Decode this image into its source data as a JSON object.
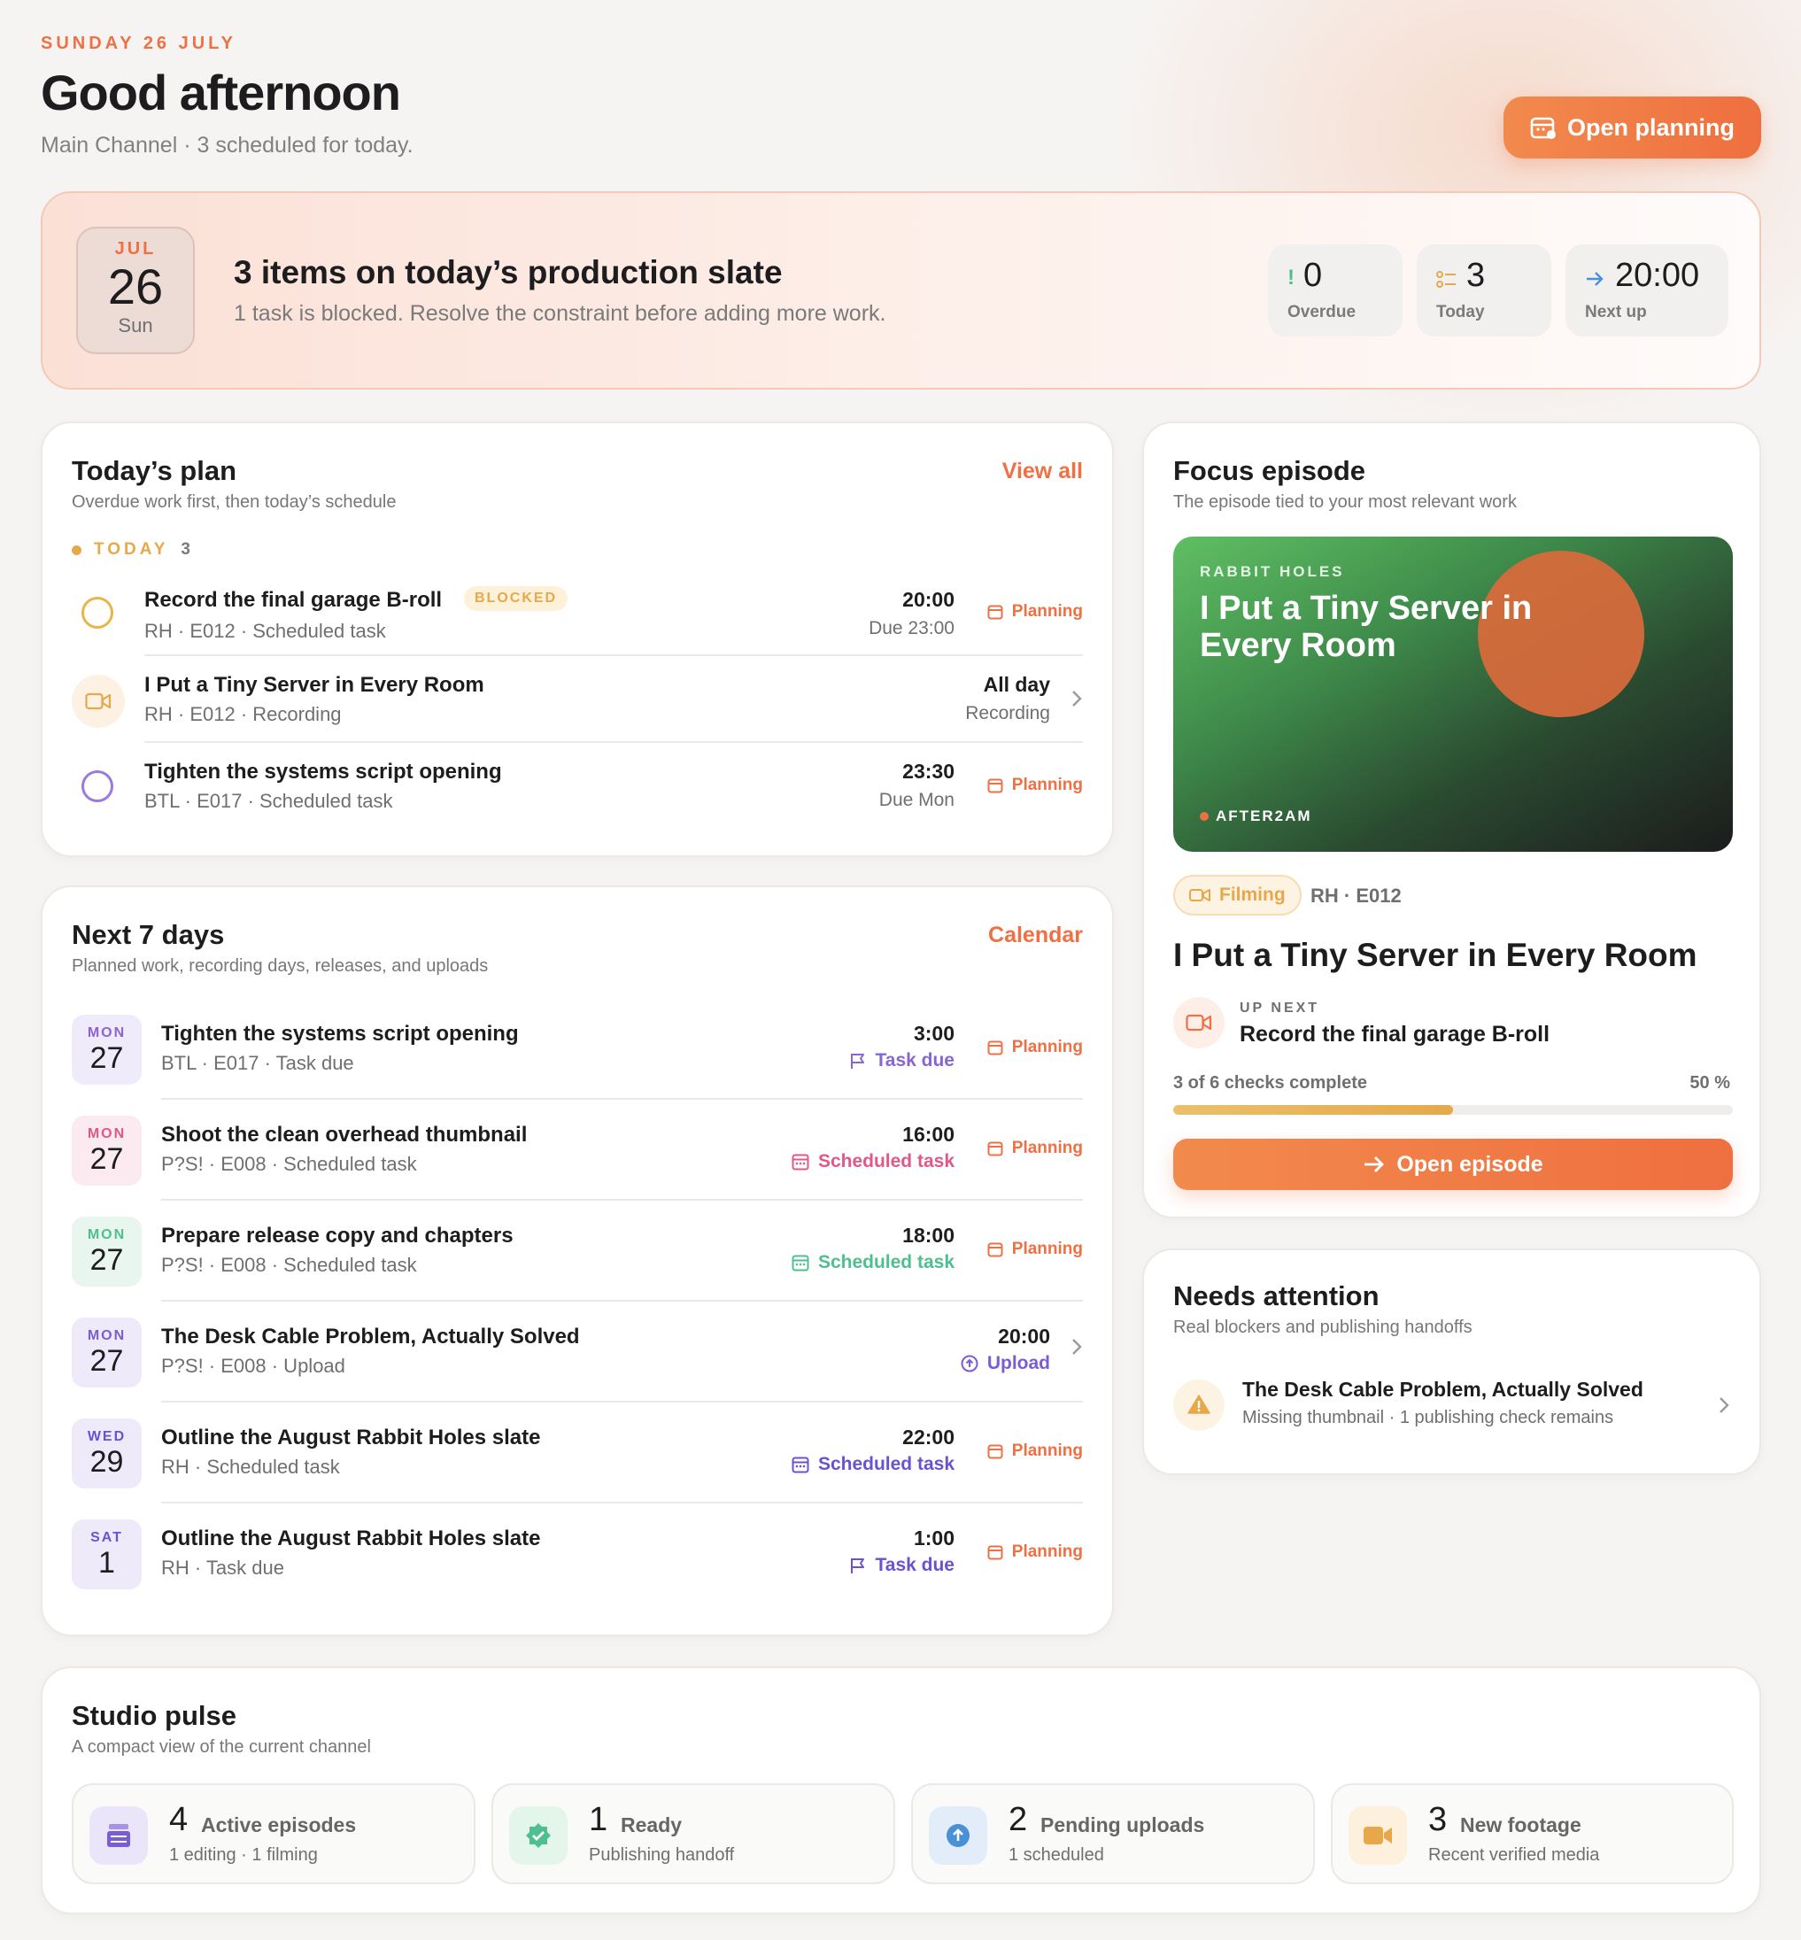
{
  "header": {
    "date_eyebrow": "SUNDAY 26 JULY",
    "greeting": "Good afternoon",
    "subtitle": "Main Channel · 3 scheduled for today.",
    "open_planning_label": "Open planning"
  },
  "slate": {
    "month": "JUL",
    "day": "26",
    "weekday": "Sun",
    "title": "3 items on today’s production slate",
    "subtitle": "1 task is blocked. Resolve the constraint before adding more work.",
    "stats": [
      {
        "icon": "exclamation-icon",
        "value": "0",
        "label": "Overdue"
      },
      {
        "icon": "list-icon",
        "value": "3",
        "label": "Today"
      },
      {
        "icon": "arrow-right-icon",
        "value": "20:00",
        "label": "Next up"
      }
    ]
  },
  "today_plan": {
    "title": "Today’s plan",
    "subtitle": "Overdue work first, then today’s schedule",
    "view_all": "View all",
    "section_label": "TODAY",
    "section_count": "3",
    "items": [
      {
        "title": "Record the final garage B-roll",
        "badge": "BLOCKED",
        "meta": "RH · E012 · Scheduled task",
        "time": "20:00",
        "due": "Due 23:00",
        "action": "Planning"
      },
      {
        "title": "I Put a Tiny Server in Every Room",
        "meta": "RH · E012 · Recording",
        "time": "All day",
        "due": "Recording"
      },
      {
        "title": "Tighten the systems script opening",
        "meta": "BTL · E017 · Scheduled task",
        "time": "23:30",
        "due": "Due Mon",
        "action": "Planning"
      }
    ]
  },
  "next7": {
    "title": "Next 7 days",
    "subtitle": "Planned work, recording days, releases, and uploads",
    "link": "Calendar",
    "items": [
      {
        "dow": "MON",
        "day": "27",
        "title": "Tighten the systems script opening",
        "meta": "BTL · E017 · Task due",
        "time": "3:00",
        "tag": "Task due",
        "action": "Planning",
        "color": "#8a64d6",
        "bg": "#f0ebfa"
      },
      {
        "dow": "MON",
        "day": "27",
        "title": "Shoot the clean overhead thumbnail",
        "meta": "P?S! · E008 · Scheduled task",
        "time": "16:00",
        "tag": "Scheduled task",
        "action": "Planning",
        "color": "#e0588a",
        "bg": "#fbeaf0"
      },
      {
        "dow": "MON",
        "day": "27",
        "title": "Prepare release copy and chapters",
        "meta": "P?S! · E008 · Scheduled task",
        "time": "18:00",
        "tag": "Scheduled task",
        "action": "Planning",
        "color": "#4fbf8f",
        "bg": "#e8f6ef"
      },
      {
        "dow": "MON",
        "day": "27",
        "title": "The Desk Cable Problem, Actually Solved",
        "meta": "P?S! · E008 · Upload",
        "time": "20:00",
        "tag": "Upload",
        "color": "#7a5cd6",
        "bg": "#efeafa"
      },
      {
        "dow": "WED",
        "day": "29",
        "title": "Outline the August Rabbit Holes slate",
        "meta": "RH · Scheduled task",
        "time": "22:00",
        "tag": "Scheduled task",
        "action": "Planning",
        "color": "#6a52d0",
        "bg": "#eeeafa"
      },
      {
        "dow": "SAT",
        "day": "1",
        "title": "Outline the August Rabbit Holes slate",
        "meta": "RH · Task due",
        "time": "1:00",
        "tag": "Task due",
        "action": "Planning",
        "color": "#6a52d0",
        "bg": "#eeeafa"
      }
    ]
  },
  "focus": {
    "title": "Focus episode",
    "subtitle": "The episode tied to your most relevant work",
    "thumb_series": "RABBIT HOLES",
    "thumb_title": "I Put a Tiny Server in Every Room",
    "thumb_brand": "AFTER2AM",
    "status": "Filming",
    "code": "RH · E012",
    "episode_title": "I Put a Tiny Server in Every Room",
    "up_next_label": "UP NEXT",
    "up_next_task": "Record the final garage B-roll",
    "progress_text": "3 of 6 checks complete",
    "progress_pct": "50 %",
    "progress_value": 0.5,
    "open_label": "Open episode"
  },
  "attention": {
    "title": "Needs attention",
    "subtitle": "Real blockers and publishing handoffs",
    "item_title": "The Desk Cable Problem, Actually Solved",
    "item_meta": "Missing thumbnail · 1 publishing check remains"
  },
  "pulse": {
    "title": "Studio pulse",
    "subtitle": "A compact view of the current channel",
    "cards": [
      {
        "icon": "film-stack-icon",
        "num": "4",
        "label": "Active episodes",
        "sub": "1 editing · 1 filming"
      },
      {
        "icon": "check-badge-icon",
        "num": "1",
        "label": "Ready",
        "sub": "Publishing handoff"
      },
      {
        "icon": "upload-icon",
        "num": "2",
        "label": "Pending uploads",
        "sub": "1 scheduled"
      },
      {
        "icon": "video-camera-icon",
        "num": "3",
        "label": "New footage",
        "sub": "Recent verified media"
      }
    ]
  }
}
